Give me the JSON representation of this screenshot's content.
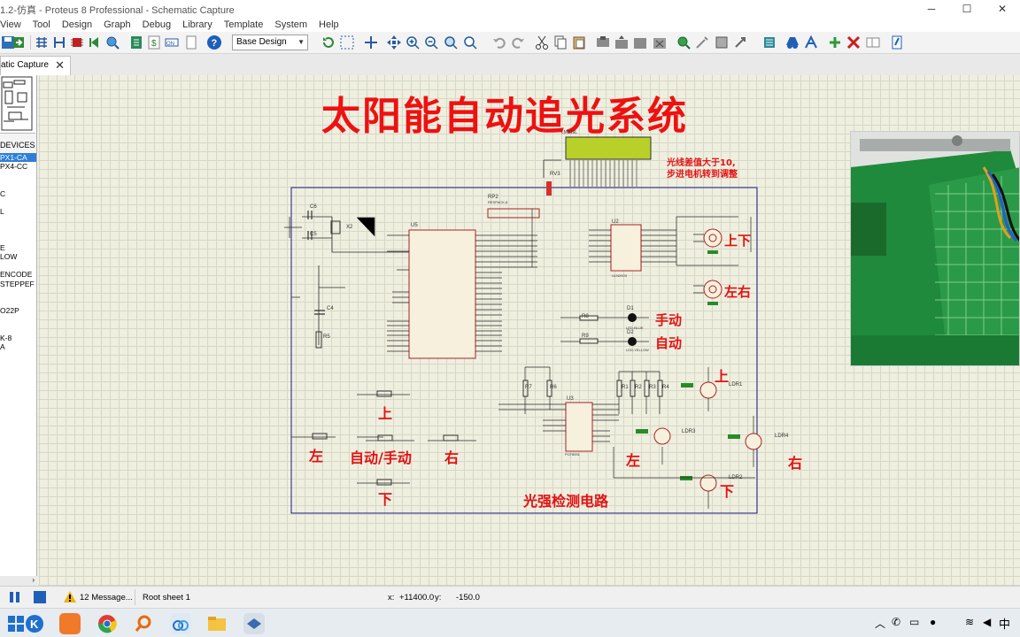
{
  "window": {
    "title": "1.2-仿真 - Proteus 8 Professional - Schematic Capture"
  },
  "menu": [
    "View",
    "Tool",
    "Design",
    "Graph",
    "Debug",
    "Library",
    "Template",
    "System",
    "Help"
  ],
  "toolbar": {
    "design_select": "Base Design"
  },
  "tab": {
    "label": "atic Capture"
  },
  "devices": {
    "header": "DEVICES",
    "items": [
      "PX1-CA",
      "PX4-CC",
      "",
      "",
      "C",
      "",
      "L",
      "",
      "",
      "",
      "E",
      "LOW",
      "",
      "ENCODE",
      "STEPPEF",
      "",
      "",
      "O22P",
      "",
      "",
      "K-8",
      "A",
      ""
    ]
  },
  "schematic": {
    "title": "太阳能自动追光系统",
    "note_line1": "光线差值大于10,",
    "note_line2": "步进电机转到调整",
    "motor1_label": "上下",
    "motor2_label": "左右",
    "led1_label": "手动",
    "led2_label": "自动",
    "btn_up": "上",
    "btn_left": "左",
    "btn_mode": "自动/手动",
    "btn_right": "右",
    "btn_down": "下",
    "circuit_label": "光强检测电路",
    "ldr1_label": "上",
    "ldr3_label": "左",
    "ldr2_label": "下",
    "ldr4_label": "右",
    "components": {
      "lcd": "LM016L",
      "rv3": "RV3",
      "rp2": "RP2",
      "rp2_type": "RESPACK-8",
      "u5": "U5",
      "u2": "U2",
      "u2_type": "ULN2003",
      "u3": "U3",
      "u3_type": "PCF8591",
      "c6": "C6",
      "c5": "C5",
      "c4": "C4",
      "x2": "X2",
      "r5": "R5",
      "r8": "R8",
      "r9": "R9",
      "d1": "D1",
      "d2": "D2",
      "led_blue": "LED-BLUE",
      "led_yellow": "LED-YELLOW",
      "r7": "R7",
      "r6": "R6",
      "r1": "R1",
      "r2": "R2",
      "r3": "R3",
      "r4": "R4",
      "ldr1": "LDR1",
      "ldr2": "LDR2",
      "ldr3": "LDR3",
      "ldr4": "LDR4"
    }
  },
  "status": {
    "messages": "12 Message...",
    "sheet": "Root sheet 1",
    "x_label": "x:",
    "x_value": "+11400.0",
    "y_label": "y:",
    "y_value": "-150.0"
  },
  "tray": {
    "ime": "中"
  }
}
